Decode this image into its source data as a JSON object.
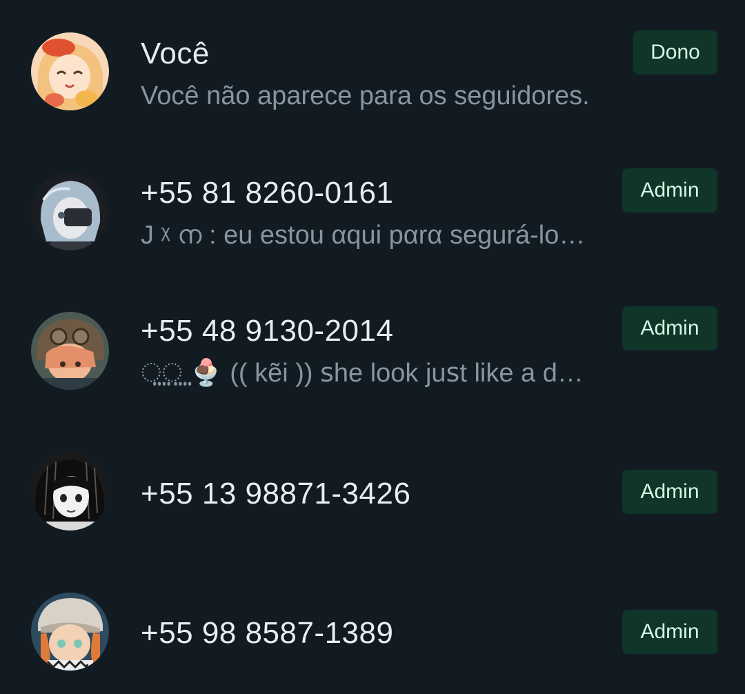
{
  "participants": [
    {
      "name": "Você",
      "status": "Você não aparece para os seguidores.",
      "role": "Dono",
      "avatar_icon": "anime-avatar-blonde-red-beret",
      "avatar_colors": [
        "#F6C69A",
        "#E8643C"
      ]
    },
    {
      "name": "+55 81 8260-0161",
      "status": "J ᵡ ന : eu estou αqui pαrα segurá-lo…",
      "role": "Admin",
      "avatar_icon": "anime-avatar-silver-hair",
      "avatar_colors": [
        "#1B1E24",
        "#AFC3D3"
      ]
    },
    {
      "name": "+55 48 9130-2014",
      "status": "⵿⵿ 🍨 (( kẽi )) ꜱhe look juꜱt like a d…",
      "role": "Admin",
      "avatar_icon": "anime-avatar-aviator-goggles",
      "avatar_colors": [
        "#6C5A46",
        "#E7A27C"
      ]
    },
    {
      "name": "+55 13 98871-3426",
      "status": "",
      "role": "Admin",
      "avatar_icon": "anime-avatar-monochrome",
      "avatar_colors": [
        "#111111",
        "#E8E8E8"
      ]
    },
    {
      "name": "+55 98 8587-1389",
      "status": "",
      "role": "Admin",
      "avatar_icon": "anime-avatar-fur-hat",
      "avatar_colors": [
        "#3B5C73",
        "#E07A3A"
      ]
    }
  ],
  "theme": {
    "background": "#121B22",
    "badge_bg": "#103529",
    "badge_text": "#D8F5E4",
    "name_text": "#E9EDEF",
    "status_text": "#8696A0"
  }
}
